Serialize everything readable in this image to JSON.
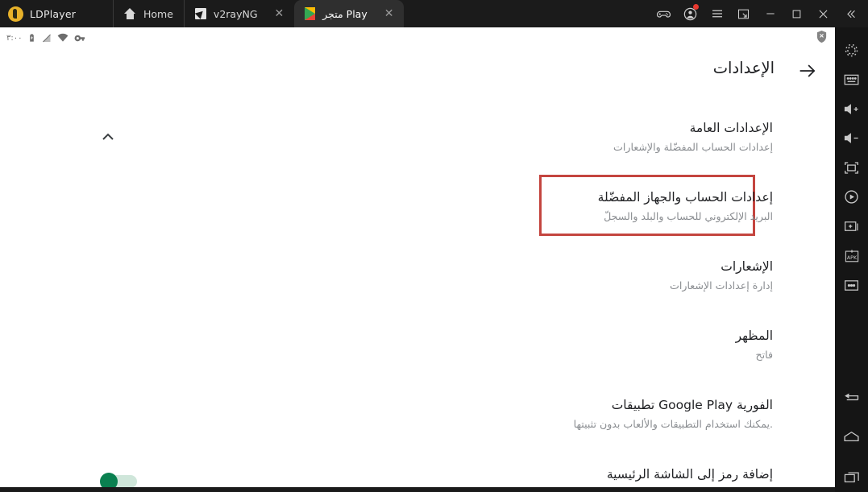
{
  "window": {
    "brand": "LDPlayer",
    "tabs": [
      {
        "label": "Home",
        "icon": "home-icon",
        "active": false,
        "closable": false
      },
      {
        "label": "v2rayNG",
        "icon": "v2rayng-icon",
        "active": false,
        "closable": true
      },
      {
        "label": "متجر Play",
        "icon": "google-play-icon",
        "active": true,
        "closable": true
      }
    ],
    "controls": [
      {
        "name": "gamepad-icon",
        "label": "Gamepad"
      },
      {
        "name": "account-icon",
        "label": "Account",
        "badge": true
      },
      {
        "name": "menu-icon",
        "label": "Menu"
      },
      {
        "name": "multi-instance-icon",
        "label": "Multi-instance"
      },
      {
        "name": "minimize-icon",
        "label": "Minimize"
      },
      {
        "name": "maximize-icon",
        "label": "Maximize"
      },
      {
        "name": "close-icon",
        "label": "Close"
      },
      {
        "name": "collapse-rail-icon",
        "label": "Collapse"
      }
    ]
  },
  "android_status_bar": {
    "time": "٣:٠٠",
    "icons": [
      "battery-charging-icon",
      "sim-off-icon",
      "wifi-icon",
      "vpn-key-icon"
    ],
    "shield_icon": "shield-off-icon"
  },
  "sidebar": {
    "items": [
      {
        "name": "settings-gear-icon",
        "label": "إعدادات المحاكي"
      },
      {
        "name": "keyboard-icon",
        "label": "لوحة المفاتيح"
      },
      {
        "name": "volume-up-icon",
        "label": "رفع الصوت"
      },
      {
        "name": "volume-down-icon",
        "label": "خفض الصوت"
      },
      {
        "name": "fullscreen-icon",
        "label": "ملء الشاشة"
      },
      {
        "name": "screen-record-icon",
        "label": "تسجيل الشاشة"
      },
      {
        "name": "new-instance-icon",
        "label": "نسخة جديدة"
      },
      {
        "name": "install-apk-icon",
        "label": "APK"
      },
      {
        "name": "more-options-icon",
        "label": "المزيد"
      },
      {
        "name": "back-nav-icon",
        "label": "رجوع"
      },
      {
        "name": "home-nav-icon",
        "label": "الرئيسية"
      },
      {
        "name": "recents-nav-icon",
        "label": "التطبيقات الأخيرة"
      }
    ],
    "apk_label": "APK"
  },
  "page": {
    "title": "الإعدادات",
    "back_arrow_icon": "arrow-forward-icon",
    "collapse_icon": "chevron-up-icon",
    "items": [
      {
        "title": "الإعدادات العامة",
        "subtitle": "إعدادات الحساب المفضّلة والإشعارات",
        "highlighted": false
      },
      {
        "title": "إعدادات الحساب والجهاز المفضّلة",
        "subtitle": "البريد الإلكتروني للحساب والبلد والسجلّ",
        "highlighted": true
      },
      {
        "title": "الإشعارات",
        "subtitle": "إدارة إعدادات الإشعارات",
        "highlighted": false
      },
      {
        "title": "المظهر",
        "subtitle": "فاتح",
        "highlighted": false
      },
      {
        "title": "تطبيقات Google Play الفورية",
        "subtitle": "يمكنك استخدام التطبيقات والألعاب بدون تثبيتها.",
        "highlighted": false
      },
      {
        "title": "إضافة رمز إلى الشاشة الرئيسية",
        "subtitle": "",
        "highlighted": false
      }
    ],
    "toggle": {
      "name": "add-icon-home-screen-toggle",
      "state": "on"
    }
  },
  "colors": {
    "titlebar_bg": "#1b1b1b",
    "rail_bg": "#151515",
    "highlight_border": "#c4453f",
    "toggle_on": "#0a8050",
    "accent_brand": "#e8b22a",
    "text_primary": "#202124",
    "text_secondary": "#8a8d91"
  }
}
